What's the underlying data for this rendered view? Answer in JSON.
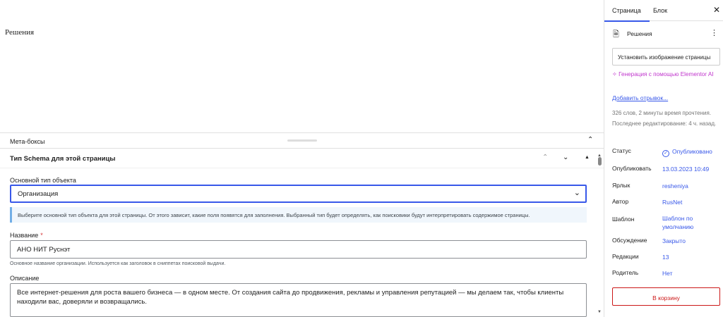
{
  "editor": {
    "post_title": "Решения"
  },
  "metaboxes": {
    "label": "Мета-боксы",
    "collapse_icon": "chevron-up-icon"
  },
  "schema": {
    "title": "Тип Schema для этой страницы",
    "object_type_label": "Основной тип объекта",
    "object_type_value": "Организация",
    "notice": "Выберите основной тип объекта для этой страницы. От этого зависит, какие поля появятся для заполнения. Выбранный тип будет определять, как поисковики будут интерпретировать содержимое страницы.",
    "name_label": "Название",
    "required_mark": "*",
    "name_value": "АНО НИТ Руснэт",
    "name_help": "Основное название организации. Используется как заголовок в сниппетах поисковой выдачи.",
    "description_label": "Описание",
    "description_value": "Все интернет-решения для роста вашего бизнеса — в одном месте. От создания сайта до продвижения, рекламы и управления репутацией — мы делаем так, чтобы клиенты находили вас, доверяли и возвращались."
  },
  "sidebar": {
    "tabs": [
      "Страница",
      "Блок"
    ],
    "active_tab": "Страница",
    "page_name": "Решения",
    "set_image_button": "Установить изображение страницы",
    "ai_link": "Генерация с помощью Elementor AI",
    "excerpt_link": "Добавить отрывок...",
    "reading_info": "326 слов, 2 минуты время прочтения.",
    "last_edited": "Последнее редактирование: 4 ч. назад.",
    "properties": [
      {
        "key": "Статус",
        "value": "Опубликовано"
      },
      {
        "key": "Опубликовать",
        "value": "13.03.2023 10:49"
      },
      {
        "key": "Ярлык",
        "value": "resheniya"
      },
      {
        "key": "Автор",
        "value": "RusNet"
      },
      {
        "key": "Шаблон",
        "value": "Шаблон по умолчанию"
      },
      {
        "key": "Обсуждение",
        "value": "Закрыто"
      },
      {
        "key": "Редакции",
        "value": "13"
      },
      {
        "key": "Родитель",
        "value": "Нет"
      }
    ],
    "trash_button": "В корзину"
  },
  "colors": {
    "accent": "#3858e9",
    "ai": "#c036cd",
    "danger": "#cc1818"
  }
}
